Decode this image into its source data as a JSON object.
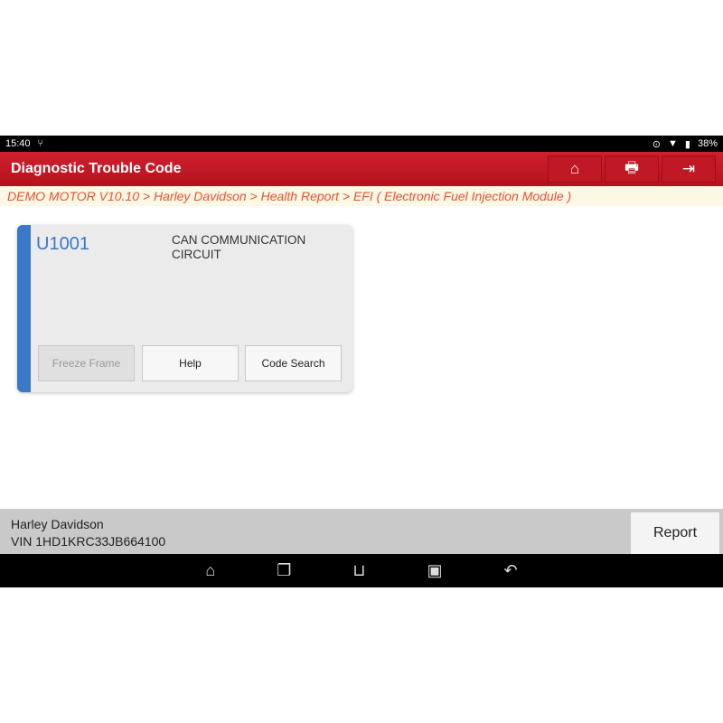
{
  "status": {
    "time": "15:40",
    "battery": "38%"
  },
  "header": {
    "title": "Diagnostic Trouble Code"
  },
  "breadcrumb": "DEMO MOTOR V10.10 > Harley Davidson > Health Report > EFI ( Electronic Fuel Injection Module )",
  "dtc": {
    "code": "U1001",
    "description": "CAN COMMUNICATION CIRCUIT",
    "buttons": {
      "freeze": "Freeze Frame",
      "help": "Help",
      "search": "Code Search"
    }
  },
  "footer": {
    "vehicle": "Harley Davidson",
    "vin": "VIN 1HD1KRC33JB664100",
    "report": "Report"
  },
  "colors": {
    "header": "#c41824",
    "accent": "#3a78c8",
    "breadcrumb": "#e8522e"
  }
}
